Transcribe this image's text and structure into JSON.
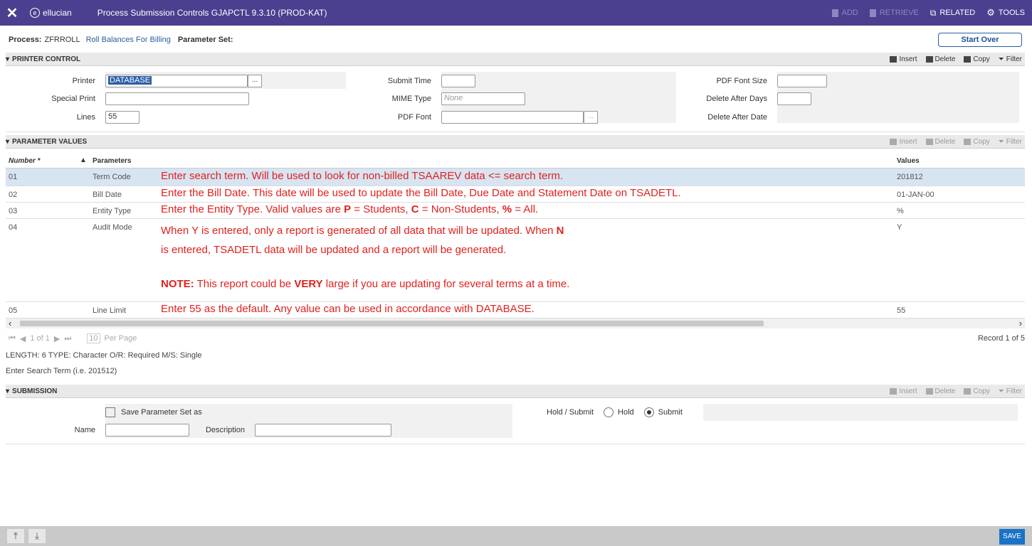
{
  "topbar": {
    "close_icon": "close-icon",
    "brand": "ellucian",
    "title": "Process Submission Controls GJAPCTL 9.3.10 (PROD-KAT)",
    "actions": [
      {
        "label": "ADD",
        "icon": "add-doc-icon",
        "enabled": false
      },
      {
        "label": "RETRIEVE",
        "icon": "retrieve-icon",
        "enabled": false
      },
      {
        "label": "RELATED",
        "icon": "related-icon",
        "enabled": true
      },
      {
        "label": "TOOLS",
        "icon": "gear-icon",
        "enabled": true
      }
    ]
  },
  "process": {
    "label": "Process:",
    "code": "ZFRROLL",
    "description": "Roll Balances For Billing",
    "param_set_label": "Parameter Set:",
    "start_over": "Start Over"
  },
  "section_tools": {
    "insert": "Insert",
    "delete": "Delete",
    "copy": "Copy",
    "filter": "Filter"
  },
  "printer_control": {
    "title": "PRINTER CONTROL",
    "printer_label": "Printer",
    "printer_value": "DATABASE",
    "printer_lookup": "...",
    "special_print_label": "Special Print",
    "special_print_value": "",
    "lines_label": "Lines",
    "lines_value": "55",
    "submit_time_label": "Submit Time",
    "submit_time_value": "",
    "mime_type_label": "MIME Type",
    "mime_type_placeholder": "None",
    "pdf_font_label": "PDF Font",
    "pdf_font_value": "",
    "pdf_font_lookup": "...",
    "pdf_font_size_label": "PDF Font Size",
    "pdf_font_size_value": "",
    "delete_after_days_label": "Delete After Days",
    "delete_after_days_value": "",
    "delete_after_date_label": "Delete After Date"
  },
  "parameter_values": {
    "title": "PARAMETER VALUES",
    "col_number": "Number *",
    "col_parameters": "Parameters",
    "col_values": "Values",
    "rows": [
      {
        "number": "01",
        "parameter": "Term Code",
        "value": "201812",
        "note": "Enter search term. Will be used to look for non-billed TSAAREV data <= search term."
      },
      {
        "number": "02",
        "parameter": "Bill Date",
        "value": "01-JAN-00",
        "note": "Enter the Bill Date.  This date will be used to update the Bill Date, Due Date and Statement Date on TSADETL."
      },
      {
        "number": "03",
        "parameter": "Entity Type",
        "value": "%",
        "note_a": "Enter the Entity Type.  Valid values are ",
        "note_p": "P",
        "note_b": " = Students, ",
        "note_c": "C",
        "note_d": " = Non-Students, ",
        "note_pct": "%",
        "note_e": " = All."
      },
      {
        "number": "04",
        "parameter": "Audit Mode",
        "value": "Y",
        "note_1a": "When Y is entered, only a report is generated of all data that will be updated. When ",
        "note_1n": "N",
        "note_2": "is entered, TSADETL data will be updated and a report will be generated.",
        "note_3label": "NOTE:",
        "note_3a": " This report could be ",
        "note_3very": "VERY",
        "note_3b": " large if you are updating for several terms at a time."
      },
      {
        "number": "05",
        "parameter": "Line Limit",
        "value": "55",
        "note": "Enter 55 as the default.  Any value can be used in accordance with DATABASE."
      }
    ],
    "pager_text": "1 of 1",
    "per_page_value": "10",
    "per_page_label": "Per Page",
    "record_text": "Record 1 of 5",
    "info_line": "LENGTH: 6 TYPE: Character O/R: Required M/S: Single",
    "hint_line": "Enter Search Term (i.e. 201512)"
  },
  "submission": {
    "title": "SUBMISSION",
    "save_param_label": "Save Parameter Set as",
    "name_label": "Name",
    "description_label": "Description",
    "hold_submit_label": "Hold / Submit",
    "hold_label": "Hold",
    "submit_label": "Submit",
    "selected": "Submit"
  },
  "footer": {
    "save": "SAVE"
  }
}
